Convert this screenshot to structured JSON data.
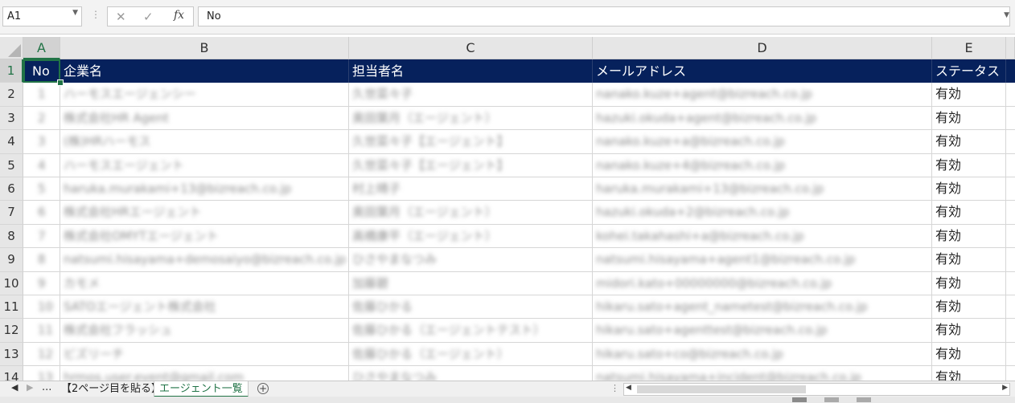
{
  "formula_bar": {
    "name_box": "A1",
    "separator": "⋮",
    "cancel_glyph": "✕",
    "enter_glyph": "✓",
    "fx_glyph": "fx",
    "content": "No"
  },
  "columns": [
    "A",
    "B",
    "C",
    "D",
    "E"
  ],
  "rows": [
    "1",
    "2",
    "3",
    "4",
    "5",
    "6",
    "7",
    "8",
    "9",
    "10",
    "11",
    "12",
    "13",
    "14"
  ],
  "header": [
    "No",
    "企業名",
    "担当者名",
    "メールアドレス",
    "ステータス"
  ],
  "data_rows": [
    {
      "no": "1",
      "company": "ハーモスエージェンシー",
      "contact": "久世菜々子",
      "email": "nanako.kuze+agent@bizreach.co.jp",
      "status": "有効"
    },
    {
      "no": "2",
      "company": "株式会社HR Agent",
      "contact": "奥田葉月（エージェント）",
      "email": "hazuki.okuda+agent@bizreach.co.jp",
      "status": "有効"
    },
    {
      "no": "3",
      "company": "(株)HRハーモス",
      "contact": "久世菜々子【エージェント】",
      "email": "nanako.kuze+a@bizreach.co.jp",
      "status": "有効"
    },
    {
      "no": "4",
      "company": "ハーモスエージェント",
      "contact": "久世菜々子【エージェント】",
      "email": "nanako.kuze+4@bizreach.co.jp",
      "status": "有効"
    },
    {
      "no": "5",
      "company": "haruka.murakami+13@bizreach.co.jp",
      "contact": "村上晴子",
      "email": "haruka.murakami+13@bizreach.co.jp",
      "status": "有効"
    },
    {
      "no": "6",
      "company": "株式会社HRエージェント",
      "contact": "奥田葉月（エージェント）",
      "email": "hazuki.okuda+2@bizreach.co.jp",
      "status": "有効"
    },
    {
      "no": "7",
      "company": "株式会社OMYTエージェント",
      "contact": "高橋康平（エージェント）",
      "email": "kohei.takahashi+a@bizreach.co.jp",
      "status": "有効"
    },
    {
      "no": "8",
      "company": "natsumi.hisayama+demosaiyo@bizreach.co.jp",
      "contact": "ひさやまなつみ",
      "email": "natsumi.hisayama+agent1@bizreach.co.jp",
      "status": "有効"
    },
    {
      "no": "9",
      "company": "カモメ",
      "contact": "加藤碧",
      "email": "midori.kato+00000000@bizreach.co.jp",
      "status": "有効"
    },
    {
      "no": "10",
      "company": "SATOエージェント株式会社",
      "contact": "佐藤ひかる",
      "email": "hikaru.sato+agent_nametest@bizreach.co.jp",
      "status": "有効"
    },
    {
      "no": "11",
      "company": "株式会社フラッシュ",
      "contact": "佐藤ひかる（エージェントテスト）",
      "email": "hikaru.sato+agenttest@bizreach.co.jp",
      "status": "有効"
    },
    {
      "no": "12",
      "company": "ビズリーチ",
      "contact": "佐藤ひかる（エージェント）",
      "email": "hikaru.sato+co@bizreach.co.jp",
      "status": "有効"
    },
    {
      "no": "13",
      "company": "hrmos.user.event@gmail.com",
      "contact": "ひさやまなつみ",
      "email": "natsumi.hisayama+incident@bizreach.co.jp",
      "status": "有効"
    }
  ],
  "tabs": {
    "prev_glyph": "◀",
    "next_glyph": "▶",
    "more": "...",
    "sheets": [
      "【2ページ目を貼る】",
      "エージェント一覧"
    ],
    "active_sheet": 1,
    "add_glyph": "+"
  },
  "scroll": {
    "dots": "⋮",
    "left_glyph": "◀",
    "right_glyph": "▶"
  },
  "colors": {
    "header_bg": "#06215c",
    "accent": "#217346"
  }
}
